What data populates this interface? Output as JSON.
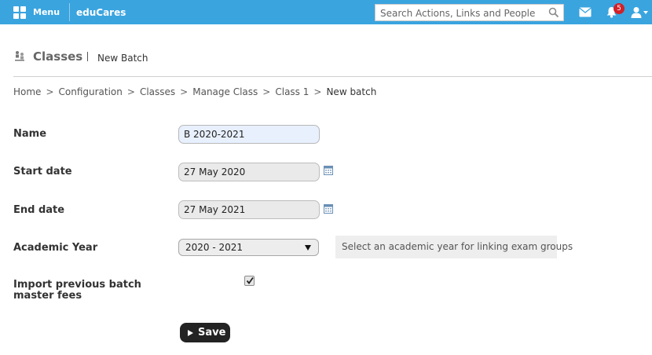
{
  "topbar": {
    "menu_label": "Menu",
    "brand": "eduCares",
    "search_placeholder": "Search Actions, Links and People",
    "notification_count": "5",
    "accent_color": "#3aa4df"
  },
  "header": {
    "title": "Classes",
    "subtitle": "New Batch",
    "icon": "classes-icon"
  },
  "breadcrumb": {
    "items": [
      "Home",
      "Configuration",
      "Classes",
      "Manage Class",
      "Class 1"
    ],
    "separator": ">",
    "current": "New batch"
  },
  "form": {
    "name_label": "Name",
    "name_value": "B 2020-2021",
    "start_date_label": "Start date",
    "start_date_value": "27 May 2020",
    "end_date_label": "End date",
    "end_date_value": "27 May 2021",
    "academic_year_label": "Academic Year",
    "academic_year_value": "2020 - 2021",
    "academic_year_hint": "Select an academic year for linking exam groups",
    "import_fees_label": "Import previous batch master fees",
    "import_fees_checked": true,
    "save_label": "Save"
  }
}
